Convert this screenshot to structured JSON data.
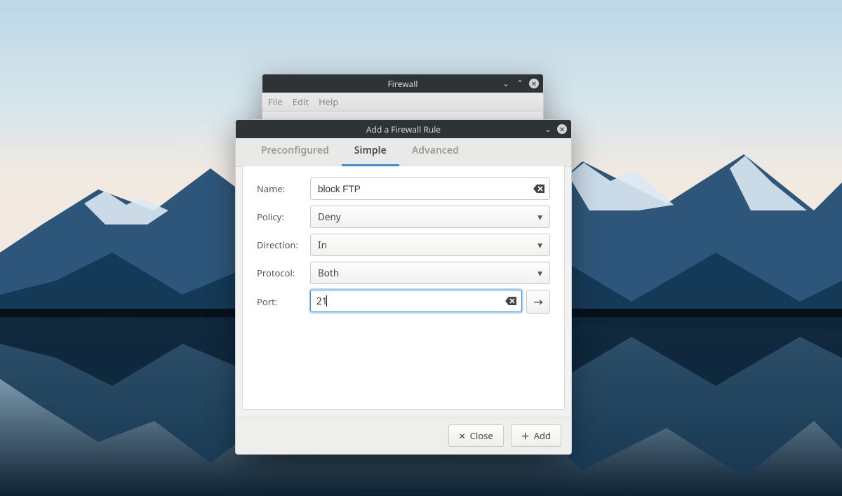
{
  "parent_window": {
    "title": "Firewall",
    "menu": {
      "file": "File",
      "edit": "Edit",
      "help": "Help"
    }
  },
  "dialog": {
    "title": "Add a Firewall Rule",
    "tabs": {
      "preconfigured": "Preconfigured",
      "simple": "Simple",
      "advanced": "Advanced",
      "active": "simple"
    },
    "form": {
      "name": {
        "label": "Name:",
        "value": "block FTP"
      },
      "policy": {
        "label": "Policy:",
        "value": "Deny"
      },
      "direction": {
        "label": "Direction:",
        "value": "In"
      },
      "protocol": {
        "label": "Protocol:",
        "value": "Both"
      },
      "port": {
        "label": "Port:",
        "value": "21"
      }
    },
    "buttons": {
      "close": "Close",
      "add": "Add"
    }
  },
  "icons": {
    "clear": "backspace-icon",
    "arrow_right": "arrow-right-icon",
    "caret": "chevron-down-icon",
    "close_x": "close-icon",
    "plus": "plus-icon",
    "minimize": "chevron-down-icon",
    "maximize": "chevron-up-icon"
  }
}
